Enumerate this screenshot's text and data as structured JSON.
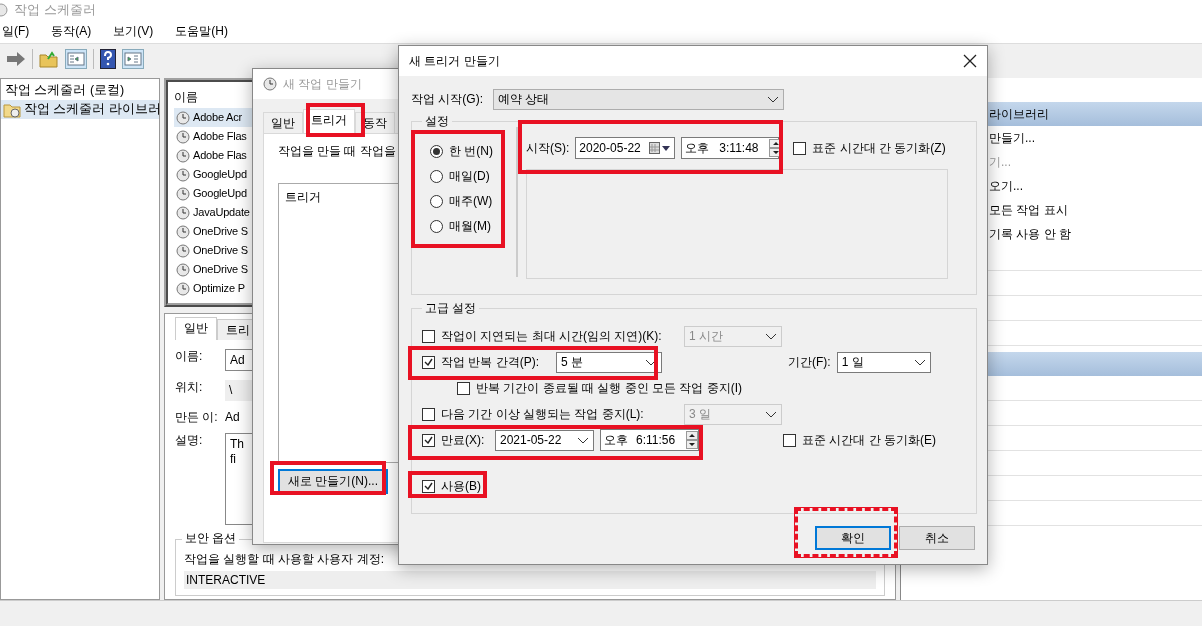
{
  "main_window": {
    "title": "작업 스케줄러",
    "menu": [
      "일(F)",
      "동작(A)",
      "보기(V)",
      "도움말(H)"
    ]
  },
  "tree": {
    "items": [
      {
        "label": "작업 스케줄러 (로컬)",
        "selected": false
      },
      {
        "label": "작업 스케줄러 라이브러",
        "selected": true
      }
    ]
  },
  "task_list": {
    "column": "이름",
    "rows": [
      {
        "name": "Adobe Acr",
        "selected": true
      },
      {
        "name": "Adobe Flas",
        "selected": false
      },
      {
        "name": "Adobe Flas",
        "selected": false
      },
      {
        "name": "GoogleUpd",
        "selected": false
      },
      {
        "name": "GoogleUpd",
        "selected": false
      },
      {
        "name": "JavaUpdate",
        "selected": false
      },
      {
        "name": "OneDrive S",
        "selected": false
      },
      {
        "name": "OneDrive S",
        "selected": false
      },
      {
        "name": "OneDrive S",
        "selected": false
      },
      {
        "name": "Optimize P",
        "selected": false
      }
    ]
  },
  "details": {
    "tabs": [
      {
        "label": "일반",
        "selected": true
      },
      {
        "label": "트리",
        "selected": false
      }
    ],
    "fields": [
      {
        "kind": "input",
        "label": "이름:",
        "value": "Ad"
      },
      {
        "kind": "readonly",
        "label": "위치:",
        "value": "\\"
      },
      {
        "kind": "text",
        "label": "만든 이:",
        "value": "Ad"
      },
      {
        "kind": "textarea",
        "label": "설명:",
        "lines": [
          "Th",
          "fi"
        ]
      }
    ],
    "security": {
      "title": "보안 옵션",
      "label": "작업을 실행할 때 사용할 사용자 계정:",
      "value": "INTERACTIVE"
    }
  },
  "actions_pane": {
    "items": [
      {
        "kind": "header",
        "label": "라이브러리"
      },
      {
        "kind": "item",
        "label": "만들기...",
        "disabled": false
      },
      {
        "kind": "item",
        "label": "기...",
        "disabled": true
      },
      {
        "kind": "item",
        "label": "오기...",
        "disabled": false
      },
      {
        "kind": "item",
        "label": "모든 작업 표시",
        "disabled": false
      },
      {
        "kind": "item",
        "label": "기록 사용 안 함",
        "disabled": false
      },
      {
        "kind": "blank"
      },
      {
        "kind": "blank"
      },
      {
        "kind": "blank"
      },
      {
        "kind": "blank"
      },
      {
        "kind": "header"
      },
      {
        "kind": "blank"
      },
      {
        "kind": "blank"
      },
      {
        "kind": "blank"
      },
      {
        "kind": "blank"
      },
      {
        "kind": "blank"
      },
      {
        "kind": "blank"
      }
    ]
  },
  "task_dialog": {
    "title": "새 작업 만들기",
    "tabs": [
      {
        "label": "일반",
        "selected": false
      },
      {
        "label": "트리거",
        "selected": true
      },
      {
        "label": "동작",
        "selected": false
      }
    ],
    "description": "작업을 만들 때 작업을",
    "list_column": "트리거",
    "new_button": "새로 만들기(N)..."
  },
  "trigger_dialog": {
    "title": "새 트리거 만들기",
    "begin": {
      "label": "작업 시작(G):",
      "value": "예약 상태"
    },
    "settings": {
      "title": "설정",
      "schedules": [
        {
          "label": "한 번(N)",
          "selected": true
        },
        {
          "label": "매일(D)",
          "selected": false
        },
        {
          "label": "매주(W)",
          "selected": false
        },
        {
          "label": "매월(M)",
          "selected": false
        }
      ],
      "start": {
        "label": "시작(S):",
        "date": "2020-05-22",
        "ampm": "오후",
        "time": "3:11:48"
      },
      "sync": {
        "label": "표준 시간대 간 동기화(Z)",
        "checked": false
      }
    },
    "advanced": {
      "title": "고급 설정",
      "delay": {
        "label": "작업이 지연되는 최대 시간(임의 지연)(K):",
        "checked": false,
        "value": "1 시간",
        "disabled": true
      },
      "repeat": {
        "label": "작업 반복 간격(P):",
        "checked": true,
        "value": "5 분",
        "duration_label": "기간(F):",
        "duration": "1 일"
      },
      "stop_all": {
        "label": "반복 기간이 종료될 때 실행 중인 모든 작업 중지(I)",
        "checked": false
      },
      "stop_long": {
        "label": "다음 기간 이상 실행되는 작업 중지(L):",
        "checked": false,
        "value": "3 일",
        "disabled": true
      },
      "expire": {
        "label": "만료(X):",
        "checked": true,
        "date": "2021-05-22",
        "ampm": "오후",
        "time": "6:11:56",
        "sync_label": "표준 시간대 간 동기화(E)",
        "sync_checked": false
      },
      "enabled": {
        "label": "사용(B)",
        "checked": true
      }
    },
    "buttons": [
      {
        "label": "확인",
        "default": true
      },
      {
        "label": "취소",
        "default": false
      }
    ]
  }
}
